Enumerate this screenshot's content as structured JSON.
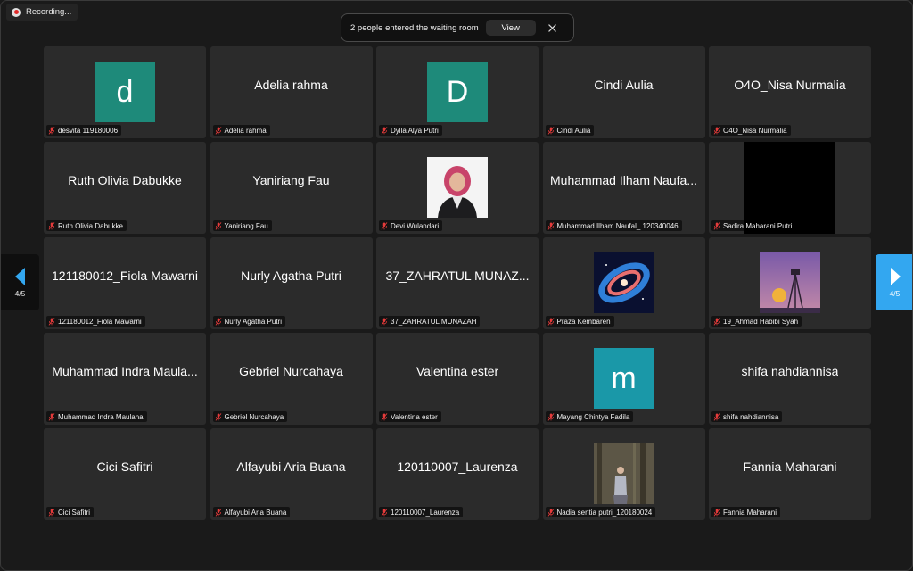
{
  "recording": {
    "label": "Recording..."
  },
  "banner": {
    "text": "2 people entered the waiting room",
    "view_label": "View",
    "close_icon": "close-icon"
  },
  "paging": {
    "left_label": "4/5",
    "right_label": "4/5",
    "accent_color": "#33a7f0"
  },
  "participants": [
    {
      "name": "desvita 119180006",
      "display": "",
      "avatar": "d",
      "avatar_color": "#1e8a7a",
      "muted": true
    },
    {
      "name": "Adelia rahma",
      "display": "Adelia rahma",
      "muted": true
    },
    {
      "name": "Dylla Alya Putri",
      "display": "",
      "avatar": "D",
      "avatar_color": "#1e8a7a",
      "muted": true
    },
    {
      "name": "Cindi Aulia",
      "display": "Cindi Aulia",
      "muted": true
    },
    {
      "name": "O4O_Nisa Nurmalia",
      "display": "O4O_Nisa Nurmalia",
      "muted": true
    },
    {
      "name": "Ruth Olivia Dabukke",
      "display": "Ruth Olivia Dabukke",
      "muted": true
    },
    {
      "name": "Yaniriang Fau",
      "display": "Yaniriang Fau",
      "muted": true
    },
    {
      "name": "Devi Wulandari",
      "display": "",
      "photo": "person-photo",
      "muted": true
    },
    {
      "name": "Muhammad Ilham Naufal_ 120340046",
      "display": "Muhammad Ilham Naufa...",
      "muted": true
    },
    {
      "name": "Sadira Maharani Putri",
      "display": "",
      "video": "black-video",
      "muted": true
    },
    {
      "name": "121180012_Fiola Mawarni",
      "display": "121180012_Fiola Mawarni",
      "muted": true
    },
    {
      "name": "Nurly Agatha Putri",
      "display": "Nurly Agatha Putri",
      "muted": true
    },
    {
      "name": "37_ZAHRATUL MUNAZAH",
      "display": "37_ZAHRATUL MUNAZ...",
      "muted": true
    },
    {
      "name": "Praza Kembaren",
      "display": "",
      "photo": "galaxy-image",
      "muted": true
    },
    {
      "name": "19_Ahmad Habibi Syah",
      "display": "",
      "photo": "tripod-image",
      "muted": true
    },
    {
      "name": "Muhammad Indra Maulana",
      "display": "Muhammad Indra Maula...",
      "muted": true
    },
    {
      "name": "Gebriel Nurcahaya",
      "display": "Gebriel Nurcahaya",
      "muted": true
    },
    {
      "name": "Valentina ester",
      "display": "Valentina ester",
      "muted": true
    },
    {
      "name": "Mayang Chintya Fadila",
      "display": "",
      "avatar": "m",
      "avatar_color": "#1a98a8",
      "muted": true
    },
    {
      "name": "shifa nahdiannisa",
      "display": "shifa nahdiannisa",
      "muted": true
    },
    {
      "name": "Cici Safitri",
      "display": "Cici Safitri",
      "muted": true
    },
    {
      "name": "Alfayubi Aria Buana",
      "display": "Alfayubi Aria Buana",
      "muted": true
    },
    {
      "name": "120110007_Laurenza",
      "display": "120110007_Laurenza",
      "muted": true
    },
    {
      "name": "Nadia sentia putri_120180024",
      "display": "",
      "photo": "forest-photo",
      "muted": true
    },
    {
      "name": "Fannia Maharani",
      "display": "Fannia Maharani",
      "muted": true
    }
  ]
}
